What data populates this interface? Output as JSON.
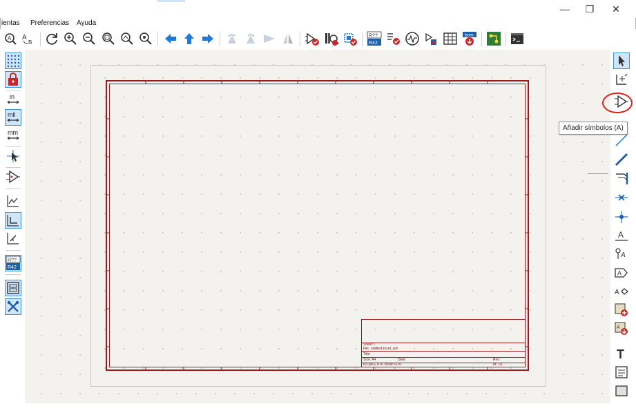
{
  "window": {
    "minimize_glyph": "—",
    "restore_glyph": "❐",
    "close_glyph": "✕"
  },
  "menubar": {
    "items": [
      {
        "label": "ientas"
      },
      {
        "label": "Preferencias"
      },
      {
        "label": "Ayuda"
      }
    ]
  },
  "toolbar": {
    "icons": [
      "find-icon",
      "find-replace-icon",
      "refresh-icon",
      "zoom-in-icon",
      "zoom-out-icon",
      "zoom-fit-icon",
      "zoom-objects-icon",
      "zoom-selection-icon",
      "navigate-back-icon",
      "navigate-up-icon",
      "navigate-forward-icon",
      "rotate-ccw-icon",
      "rotate-cw-icon",
      "mirror-horizontal-icon",
      "mirror-vertical-icon",
      "symbol-editor-icon",
      "symbol-library-browser-icon",
      "footprint-editor-icon",
      "annotate-icon",
      "erc-icon",
      "simulator-icon",
      "assign-footprints-icon",
      "fields-editor-icon",
      "bom-icon",
      "pcb-editor-icon",
      "scripting-console-icon"
    ],
    "annotate_text_top": "R??",
    "annotate_text_bottom": "R42",
    "bom_text": "bom"
  },
  "left_toolbar": {
    "unit_in": "in",
    "unit_mil": "mil",
    "unit_mm": "mm",
    "annotate_top": "R??",
    "annotate_bottom": "R42"
  },
  "right_toolbar": {
    "label_text": "A",
    "text_tool": "T"
  },
  "tooltip": {
    "text": "Añadir símbolos  (A)"
  },
  "title_block": {
    "line1": "Sheet: /",
    "line2": "File: untitled.kicad_sch",
    "line3": "Title:",
    "line4_a": "Size: A4",
    "line4_b": "Date:",
    "line4_c": "Rev:",
    "line5_a": "KiCad E.D.A.  kicad 6.0.0",
    "line5_b": "Id: 1/1"
  },
  "colors": {
    "sheet_border": "#9b1b1b",
    "canvas_bg": "#f3f2ee",
    "active_tool_bg": "#cfe5fb",
    "active_tool_border": "#3d8fd9",
    "highlight_circle": "#e0201b",
    "arrow_blue": "#1e7ad6"
  }
}
